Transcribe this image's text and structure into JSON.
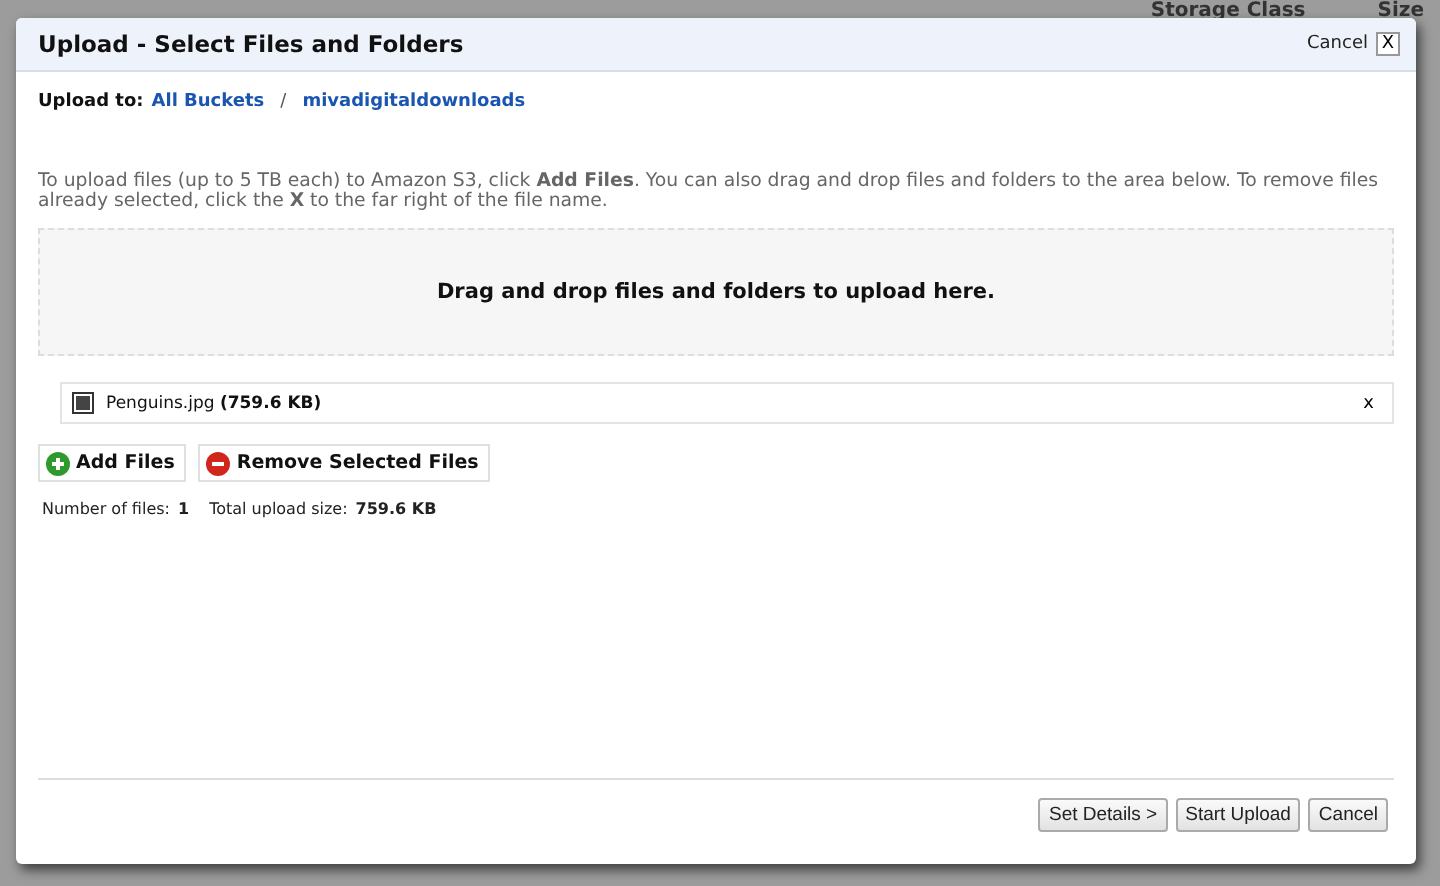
{
  "background_table": {
    "columns": [
      "Storage Class",
      "Size"
    ]
  },
  "dialog": {
    "title": "Upload - Select Files and Folders",
    "cancel_link": "Cancel",
    "close_symbol": "X",
    "breadcrumb": {
      "label": "Upload to:",
      "items": [
        "All Buckets",
        "mivadigitaldownloads"
      ],
      "separator": "/"
    },
    "intro": "To upload files (up to 5 TB each) to Amazon S3, click **Add Files**. You can also drag and drop files and folders to the area below. To remove files already selected, click the **X** to the far right of the file name.",
    "drop_zone": "Drag and drop files and folders to upload here.",
    "files": [
      {
        "name": "Penguins.jpg **(759.6 KB)**",
        "remove": "x"
      }
    ],
    "actions": [
      {
        "kind": "add",
        "label": "Add Files"
      },
      {
        "kind": "remove",
        "label": "Remove Selected Files"
      }
    ],
    "summary": [
      {
        "label": "Number of files:",
        "value": "1"
      },
      {
        "label": "Total upload size:",
        "value": "759.6 KB"
      }
    ],
    "footer_buttons": [
      "Set Details >",
      "Start Upload",
      "Cancel"
    ]
  }
}
